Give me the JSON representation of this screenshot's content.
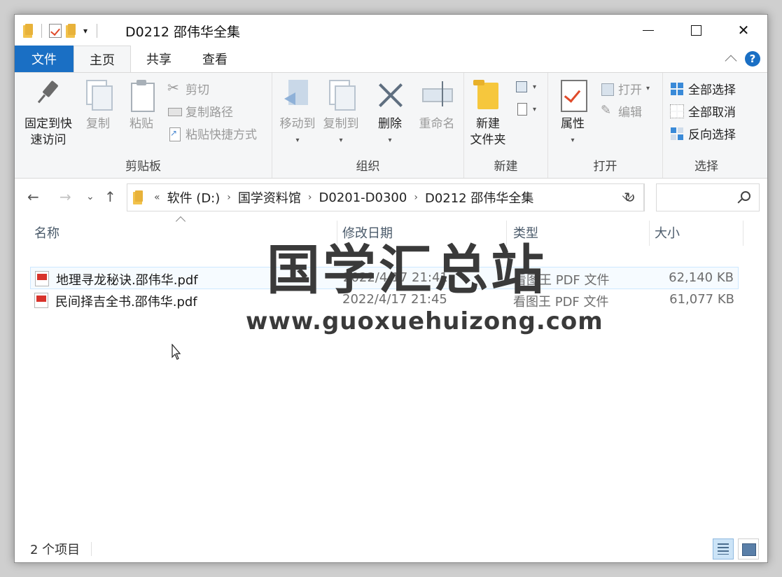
{
  "window": {
    "title": "D0212 邵伟华全集"
  },
  "tabs": [
    {
      "label": "文件"
    },
    {
      "label": "主页"
    },
    {
      "label": "共享"
    },
    {
      "label": "查看"
    }
  ],
  "ribbon": {
    "clipboard": {
      "pin_line1": "固定到快",
      "pin_line2": "速访问",
      "copy": "复制",
      "paste": "粘贴",
      "cut": "剪切",
      "copy_path": "复制路径",
      "paste_shortcut": "粘贴快捷方式",
      "label": "剪贴板"
    },
    "organize": {
      "move_to": "移动到",
      "copy_to": "复制到",
      "delete": "删除",
      "rename": "重命名",
      "label": "组织"
    },
    "new": {
      "new_folder_line1": "新建",
      "new_folder_line2": "文件夹",
      "label": "新建"
    },
    "open": {
      "properties": "属性",
      "open": "打开",
      "edit": "编辑",
      "label": "打开"
    },
    "select": {
      "select_all": "全部选择",
      "select_none": "全部取消",
      "invert": "反向选择",
      "label": "选择"
    }
  },
  "address": {
    "overflow": "«",
    "crumbs": [
      "软件 (D:)",
      "国学资料馆",
      "D0201-D0300",
      "D0212 邵伟华全集"
    ],
    "search_placeholder": ""
  },
  "columns": {
    "name": "名称",
    "modified": "修改日期",
    "type": "类型",
    "size": "大小"
  },
  "files": [
    {
      "name": "地理寻龙秘诀.邵伟华.pdf",
      "modified": "2022/4/17 21:41",
      "type": "看图王 PDF 文件",
      "size": "62,140 KB"
    },
    {
      "name": "民间择吉全书.邵伟华.pdf",
      "modified": "2022/4/17 21:45",
      "type": "看图王 PDF 文件",
      "size": "61,077 KB"
    }
  ],
  "watermark": {
    "title": "国学汇总站",
    "url": "www.guoxuehuizong.com"
  },
  "status": {
    "count": "2 个项目"
  },
  "colors": {
    "accent": "#1a6fc4",
    "selection": "#cde8ff"
  }
}
